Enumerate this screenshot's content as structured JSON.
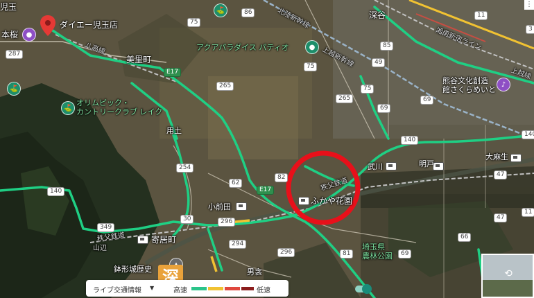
{
  "map": {
    "places": [
      {
        "key": "kodama_top",
        "text": "児玉"
      },
      {
        "key": "honjo",
        "text": "本桜"
      },
      {
        "key": "daiei",
        "text": "ダイエー児玉店"
      },
      {
        "key": "misato",
        "text": "美里町"
      },
      {
        "key": "aquaparadise",
        "text": "アクアパラダイス パティオ"
      },
      {
        "key": "olympic",
        "text": "オリムピック・\nカントリークラブ レイク"
      },
      {
        "key": "yodo",
        "text": "用土"
      },
      {
        "key": "fukaya",
        "text": "深谷"
      },
      {
        "key": "kumagaya",
        "text": "熊谷文化創造\n館さくらめいと"
      },
      {
        "key": "takekawa",
        "text": "武川"
      },
      {
        "key": "akebono",
        "text": "明戸"
      },
      {
        "key": "oaso",
        "text": "大麻生"
      },
      {
        "key": "omaeda",
        "text": "小前田"
      },
      {
        "key": "fukayahanazono",
        "text": "ふかや花園"
      },
      {
        "key": "yorii",
        "text": "寄居町"
      },
      {
        "key": "saitama_park",
        "text": "埼玉県\n農林公園"
      },
      {
        "key": "hachigata",
        "text": "鉢形城歴史"
      },
      {
        "key": "otoko",
        "text": "男衾"
      },
      {
        "key": "chichibu1",
        "text": "秩父鉄道"
      },
      {
        "key": "chichibu2",
        "text": "秩父鉄道"
      },
      {
        "key": "yamabe",
        "text": "山辺"
      }
    ],
    "rail_labels": [
      {
        "key": "hachiko",
        "text": "八高線"
      },
      {
        "key": "joetsu",
        "text": "上越新幹線"
      },
      {
        "key": "hokuriku",
        "text": "北陸新幹線"
      },
      {
        "key": "shonan",
        "text": "湘南新宿ライン"
      },
      {
        "key": "joetsu2",
        "text": "上越線"
      }
    ],
    "shields": [
      {
        "key": "s86",
        "text": "86"
      },
      {
        "key": "s75a",
        "text": "75"
      },
      {
        "key": "s287",
        "text": "287"
      },
      {
        "key": "s75b",
        "text": "75"
      },
      {
        "key": "s265",
        "text": "265"
      },
      {
        "key": "s69a",
        "text": "69"
      },
      {
        "key": "s49",
        "text": "49"
      },
      {
        "key": "s75c",
        "text": "75"
      },
      {
        "key": "s254",
        "text": "254"
      },
      {
        "key": "s62",
        "text": "62"
      },
      {
        "key": "s140a",
        "text": "140"
      },
      {
        "key": "s349",
        "text": "349"
      },
      {
        "key": "s296a",
        "text": "296"
      },
      {
        "key": "s140b",
        "text": "140"
      },
      {
        "key": "s140c",
        "text": "140"
      },
      {
        "key": "s69b",
        "text": "69"
      },
      {
        "key": "s47a",
        "text": "47"
      },
      {
        "key": "s47b",
        "text": "47"
      },
      {
        "key": "s81",
        "text": "81"
      },
      {
        "key": "s11a",
        "text": "11"
      },
      {
        "key": "s11b",
        "text": "11"
      },
      {
        "key": "s30",
        "text": "30"
      },
      {
        "key": "s3",
        "text": "3"
      },
      {
        "key": "s66",
        "text": "66"
      },
      {
        "key": "s69c",
        "text": "69"
      },
      {
        "key": "s294",
        "text": "294"
      },
      {
        "key": "s296b",
        "text": "296"
      },
      {
        "key": "s82",
        "text": "82"
      },
      {
        "key": "s85",
        "text": "85"
      },
      {
        "key": "s265b",
        "text": "265"
      }
    ],
    "expressway_labels": [
      {
        "key": "e17a",
        "text": "E17"
      },
      {
        "key": "e17b",
        "text": "E17"
      }
    ]
  },
  "traffic_bar": {
    "label": "ライブ交通情報",
    "dropdown_icon": "▼",
    "fast": "高速",
    "slow": "低速",
    "colors": [
      "#2bc48a",
      "#f1c232",
      "#e0483e",
      "#8b1d1d"
    ]
  },
  "overlay_badge": "深",
  "highlight_circle_color": "#e8101a",
  "accent_green": "#1fcf84"
}
